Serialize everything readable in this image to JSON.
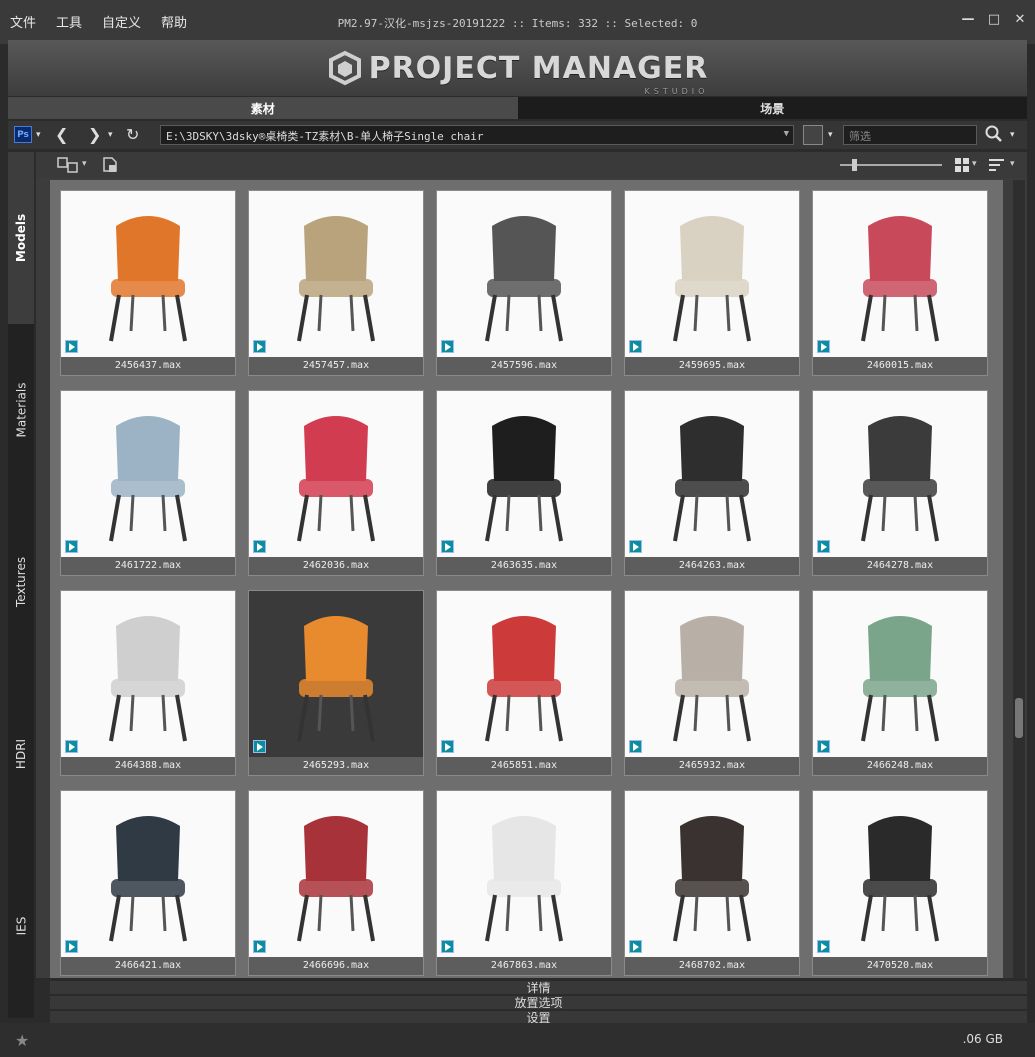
{
  "menu": [
    "文件",
    "工具",
    "自定义",
    "帮助"
  ],
  "window_title": "PM2.97-汉化-msjzs-20191222  :: Items: 332  :: Selected: 0",
  "window_controls": [
    "minimize-icon",
    "maximize-icon",
    "close-icon"
  ],
  "banner": {
    "title": "PROJECT MANAGER",
    "subtitle": "KSTUDIO"
  },
  "tabs": [
    {
      "label": "素材",
      "active": true
    },
    {
      "label": "场景",
      "active": false
    }
  ],
  "toolbar": {
    "ps_label": "Ps",
    "path": "E:\\3DSKY\\3dsky®桌椅类-TZ素材\\B-单人椅子Single chair",
    "filter_placeholder": "筛选"
  },
  "sidebar": [
    "Models",
    "Materials",
    "Textures",
    "HDRI",
    "IES"
  ],
  "items": [
    {
      "name": "2456437.max"
    },
    {
      "name": "2457457.max"
    },
    {
      "name": "2457596.max"
    },
    {
      "name": "2459695.max"
    },
    {
      "name": "2460015.max"
    },
    {
      "name": "2461722.max"
    },
    {
      "name": "2462036.max"
    },
    {
      "name": "2463635.max"
    },
    {
      "name": "2464263.max"
    },
    {
      "name": "2464278.max"
    },
    {
      "name": "2464388.max"
    },
    {
      "name": "2465293.max"
    },
    {
      "name": "2465851.max"
    },
    {
      "name": "2465932.max"
    },
    {
      "name": "2466248.max"
    },
    {
      "name": "2466421.max"
    },
    {
      "name": "2466696.max"
    },
    {
      "name": "2467863.max"
    },
    {
      "name": "2468702.max"
    },
    {
      "name": "2470520.max"
    }
  ],
  "panels": [
    "详情",
    "放置选项",
    "设置"
  ],
  "status": {
    "disk": ".06 GB"
  },
  "colors": {
    "accent": "#0d8ea0",
    "chair_colors": [
      "#e0762a",
      "#b9a37c",
      "#555555",
      "#d9d2c2",
      "#c84a5a",
      "#9bb3c4",
      "#d23c50",
      "#1e1e1e",
      "#2e2e2e",
      "#3b3b3b",
      "#cfcfcf",
      "#e88a2e",
      "#cc3a3a",
      "#b8b0a6",
      "#7aa58a",
      "#2f3a44",
      "#a8323a",
      "#e6e6e6",
      "#3a3230",
      "#2a2a2a"
    ]
  }
}
